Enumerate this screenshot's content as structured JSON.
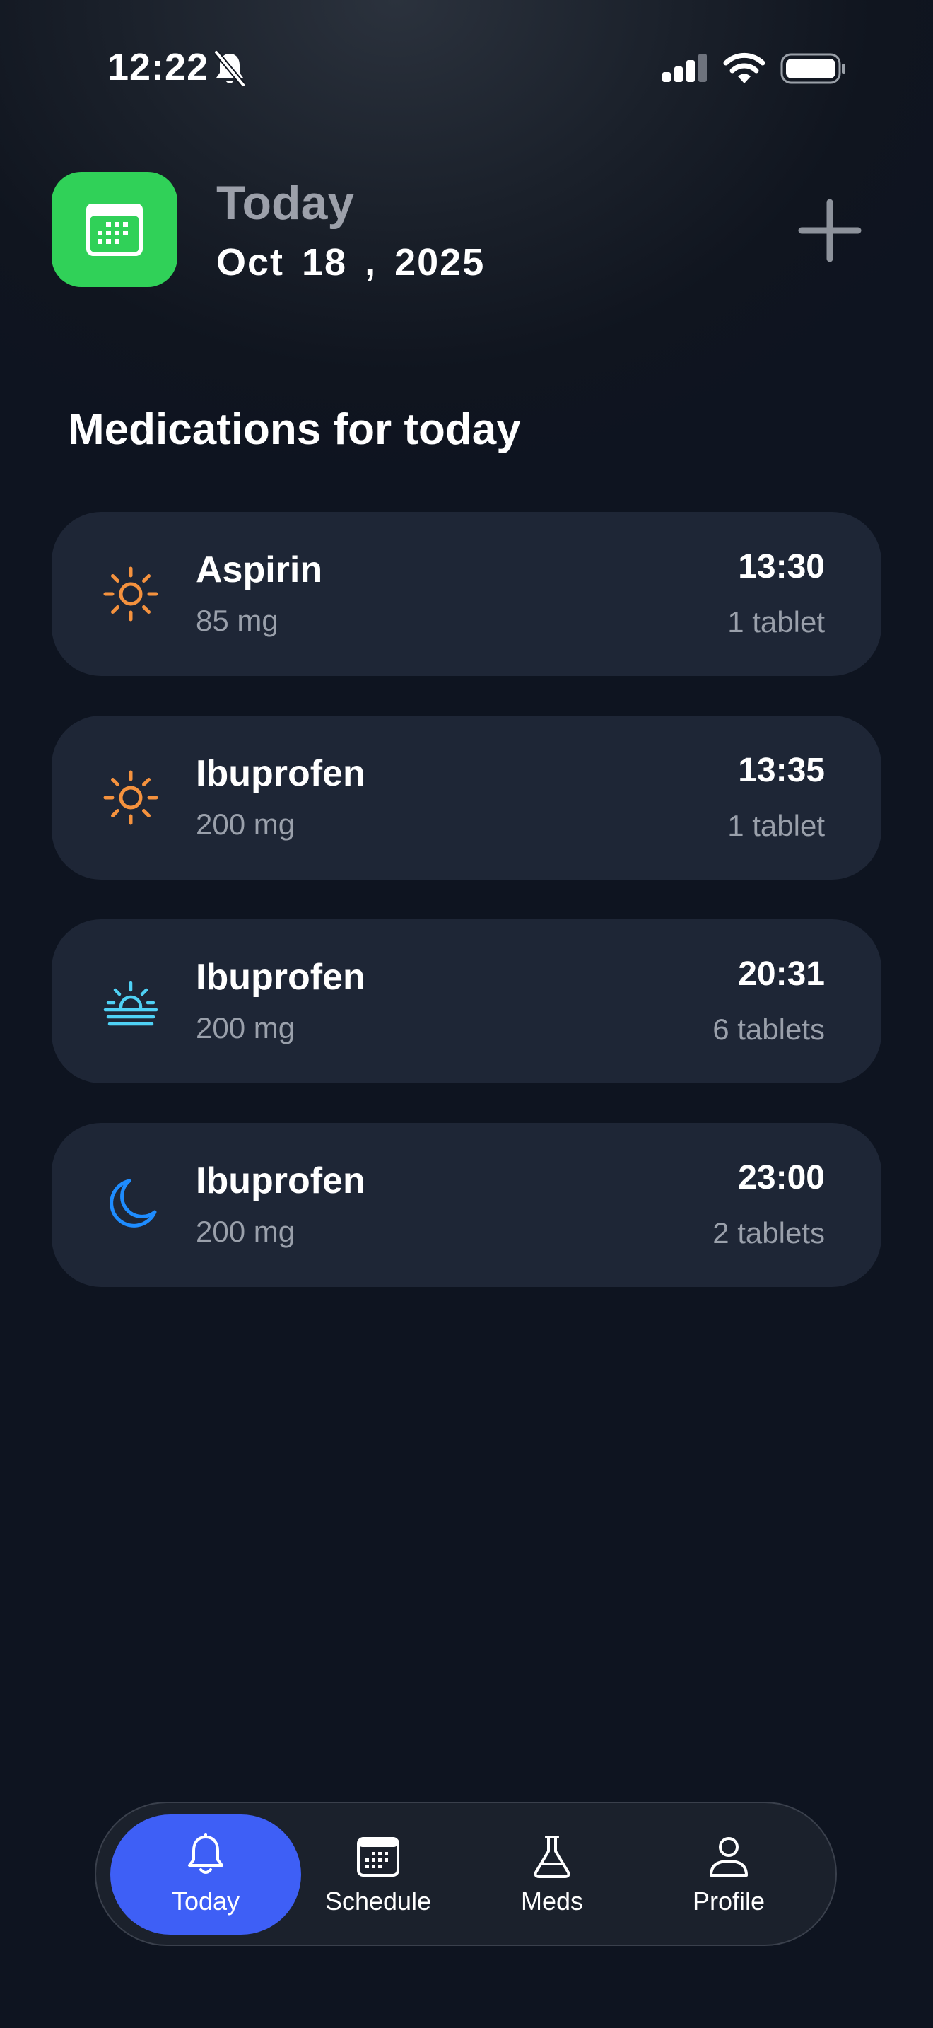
{
  "status_bar": {
    "time": "12:22"
  },
  "header": {
    "title": "Today",
    "date": "Oct 18 , 2025"
  },
  "section": {
    "title": "Medications for today"
  },
  "medications": [
    {
      "name": "Aspirin",
      "dose": "85 mg",
      "time": "13:30",
      "quantity": "1 tablet",
      "icon": "sun-icon",
      "icon_color": "#f5923e"
    },
    {
      "name": "Ibuprofen",
      "dose": "200 mg",
      "time": "13:35",
      "quantity": "1 tablet",
      "icon": "sun-icon",
      "icon_color": "#f5923e"
    },
    {
      "name": "Ibuprofen",
      "dose": "200 mg",
      "time": "20:31",
      "quantity": "6 tablets",
      "icon": "sunset-icon",
      "icon_color": "#4fd1f5"
    },
    {
      "name": "Ibuprofen",
      "dose": "200 mg",
      "time": "23:00",
      "quantity": "2 tablets",
      "icon": "moon-icon",
      "icon_color": "#1e8cff"
    }
  ],
  "tabs": [
    {
      "label": "Today",
      "icon": "bell-icon",
      "active": true
    },
    {
      "label": "Schedule",
      "icon": "calendar-icon",
      "active": false
    },
    {
      "label": "Meds",
      "icon": "flask-icon",
      "active": false
    },
    {
      "label": "Profile",
      "icon": "person-icon",
      "active": false
    }
  ],
  "colors": {
    "accent": "#3e5ff6",
    "app_icon": "#30d158",
    "card": "#1e2636"
  }
}
